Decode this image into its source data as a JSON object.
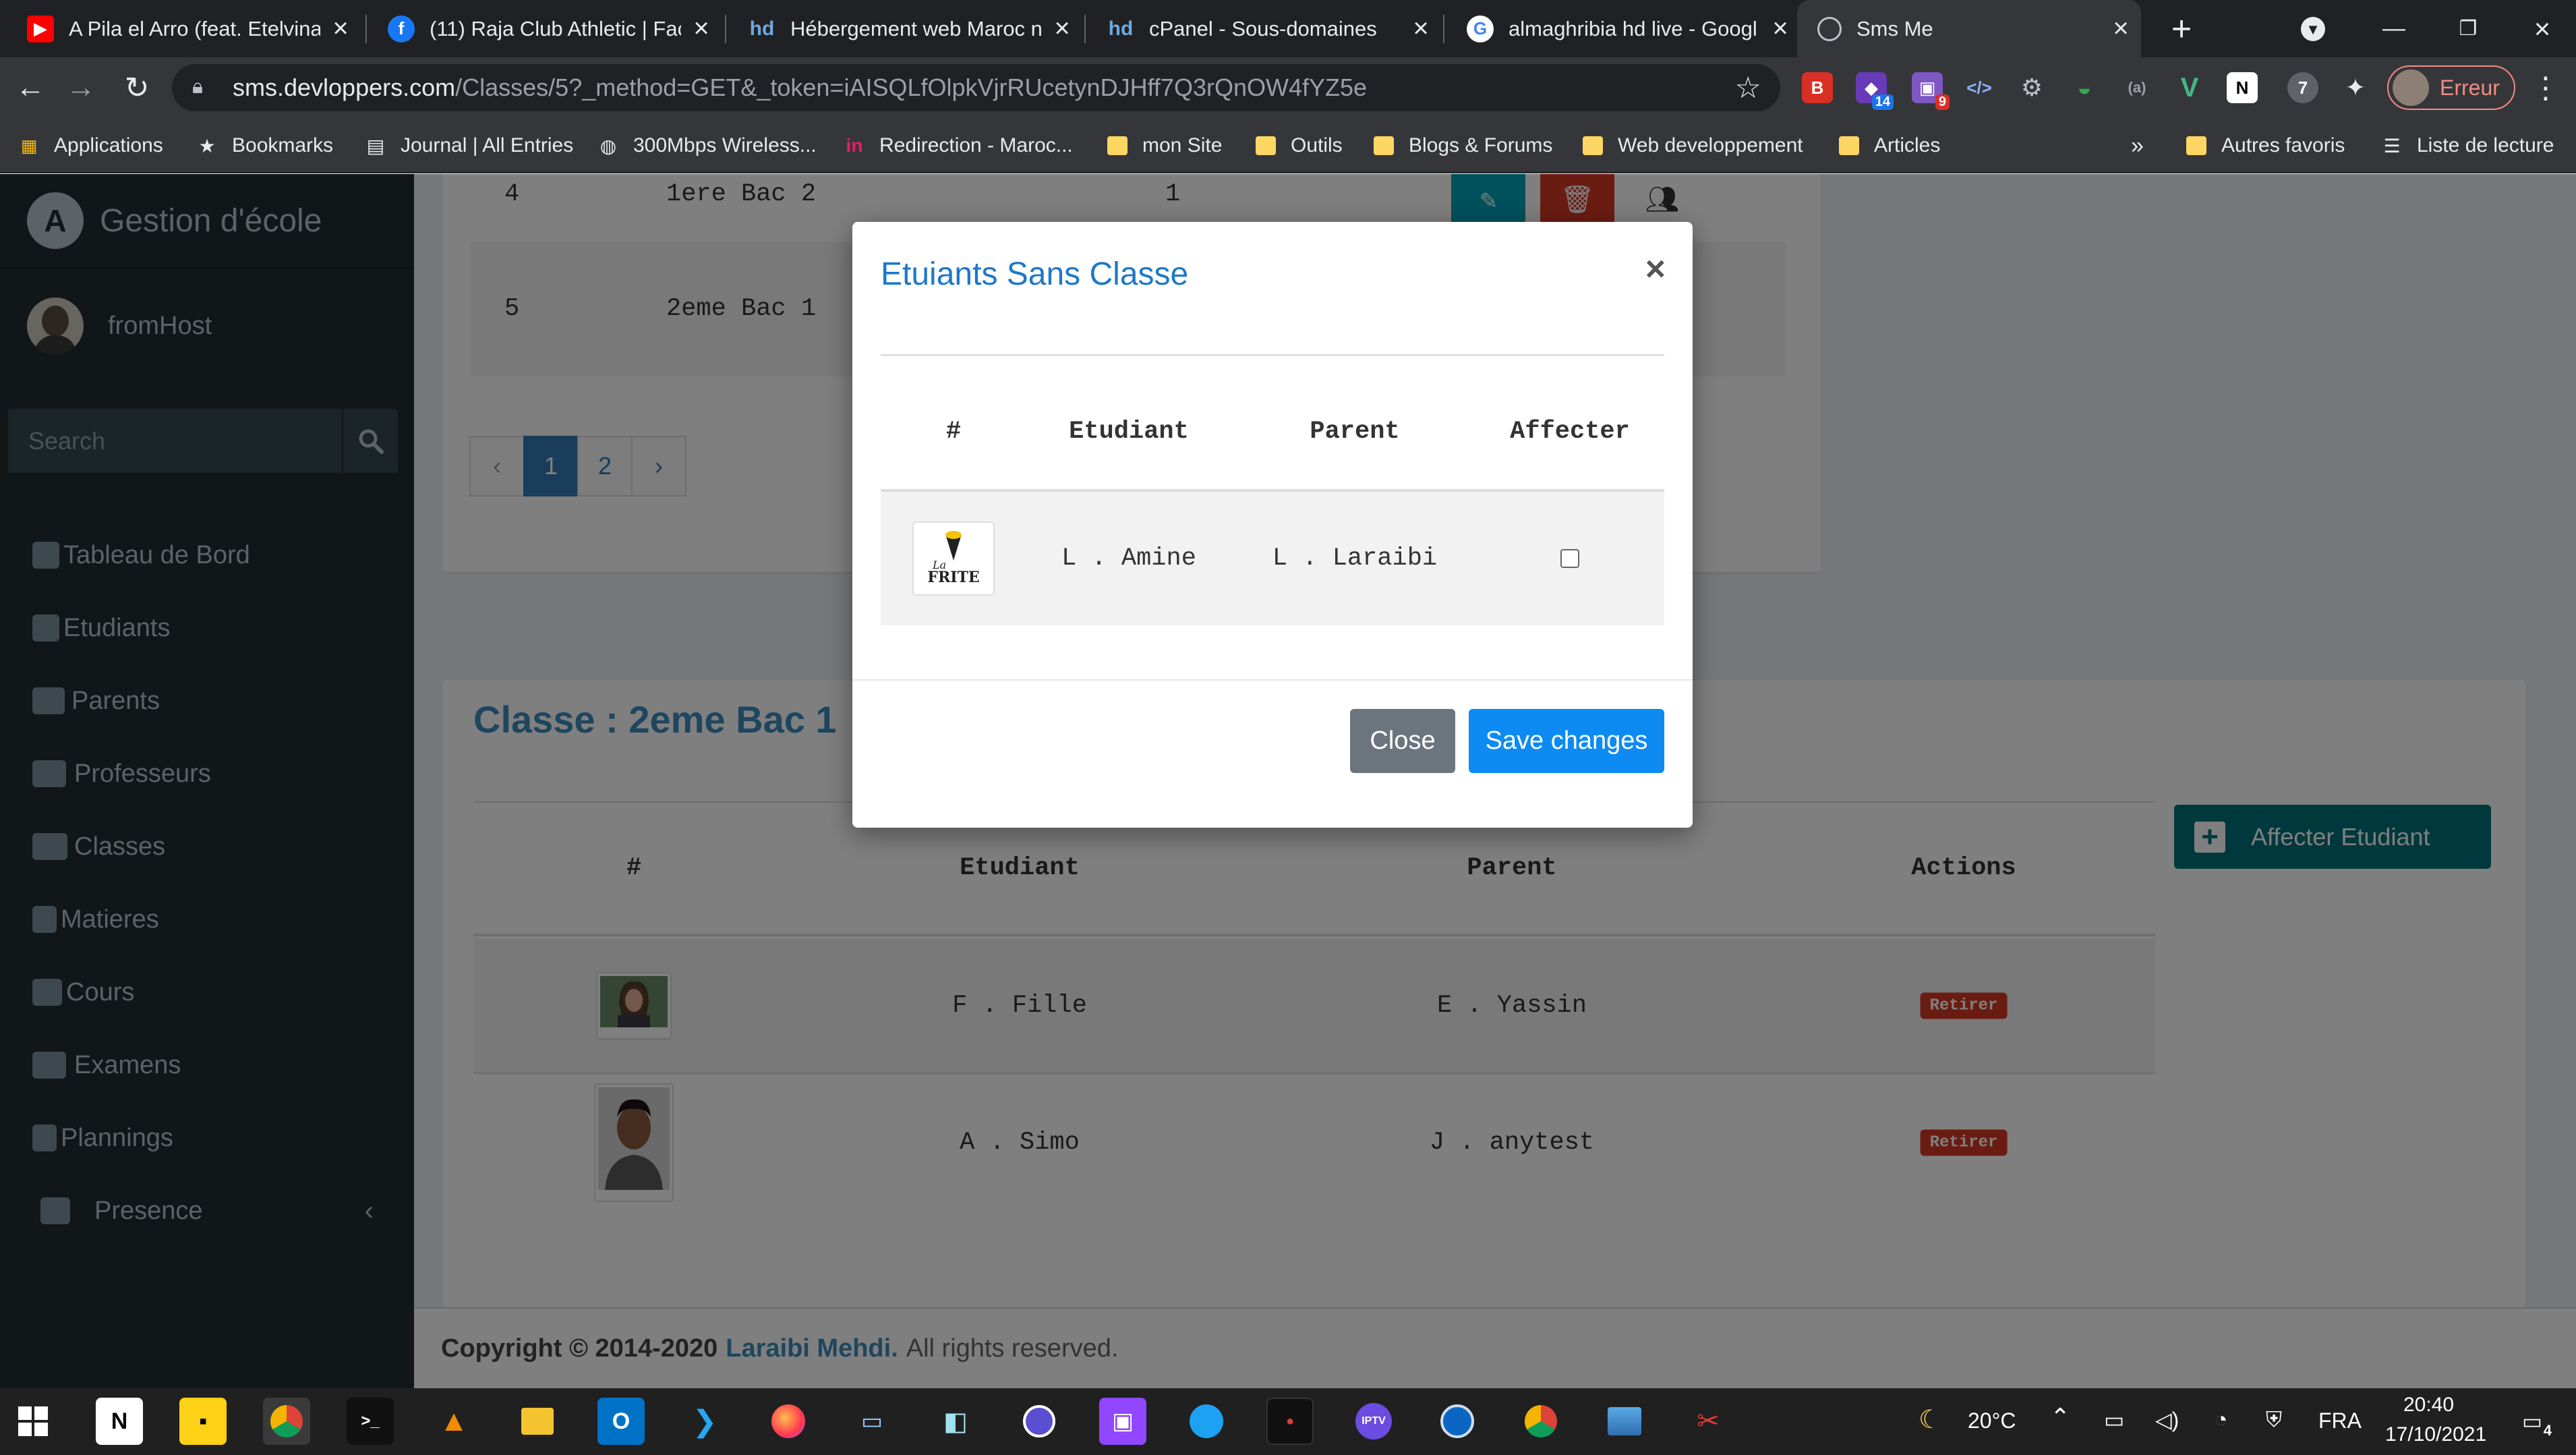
{
  "browser": {
    "tabs": [
      {
        "title": "A Pila el Arro (feat. Etelvina",
        "icon": "youtube-icon",
        "color": "#ff0000"
      },
      {
        "title": "(11) Raja Club Athletic | Face",
        "icon": "facebook-icon",
        "color": "#1877f2"
      },
      {
        "title": "Hébergement web Maroc n",
        "icon": "hd-icon",
        "color": "#2c6fba"
      },
      {
        "title": "cPanel - Sous-domaines",
        "icon": "hd-icon",
        "color": "#2c6fba"
      },
      {
        "title": "almaghribia hd live - Googl",
        "icon": "google-icon",
        "color": "#ffffff"
      },
      {
        "title": "Sms Me",
        "icon": "globe-icon",
        "color": "#bdc1c6"
      }
    ],
    "url_host": "sms.devloppers.com",
    "url_path": "/Classes/5?_method=GET&_token=iAISQLfOlpkVjrRUcetynDJHff7Q3rQnOW4fYZ5e",
    "profile_label": "Erreur",
    "extension_badges": [
      "14",
      "9"
    ],
    "bookmarks": [
      {
        "label": "Applications",
        "icon": "apps-grid-icon"
      },
      {
        "label": "Bookmarks",
        "icon": "star-icon"
      },
      {
        "label": "Journal | All Entries",
        "icon": "journal-icon"
      },
      {
        "label": "300Mbps Wireless...",
        "icon": "globe-icon"
      },
      {
        "label": "Redirection - Maroc...",
        "icon": "in-icon"
      },
      {
        "label": "mon Site",
        "icon": "folder-icon"
      },
      {
        "label": "Outils",
        "icon": "folder-icon"
      },
      {
        "label": "Blogs & Forums",
        "icon": "folder-icon"
      },
      {
        "label": "Web developpement",
        "icon": "folder-icon"
      },
      {
        "label": "Articles",
        "icon": "folder-icon"
      }
    ],
    "bookmarks_more": "»",
    "other_bookmarks": "Autres favoris",
    "reading_list": "Liste de lecture"
  },
  "sidebar": {
    "brand": "Gestion d'école",
    "user": "fromHost",
    "search_placeholder": "Search",
    "items": [
      {
        "label": "Tableau de Bord",
        "icon": "dashboard-icon"
      },
      {
        "label": "Etudiants",
        "icon": "student-icon"
      },
      {
        "label": "Parents",
        "icon": "users-icon"
      },
      {
        "label": "Professeurs",
        "icon": "teacher-icon"
      },
      {
        "label": "Classes",
        "icon": "users-group-icon"
      },
      {
        "label": "Matieres",
        "icon": "subject-icon"
      },
      {
        "label": "Cours",
        "icon": "book-icon"
      },
      {
        "label": "Examens",
        "icon": "exam-icon"
      },
      {
        "label": "Plannings",
        "icon": "calendar-icon"
      },
      {
        "label": "Presence",
        "icon": "table-icon"
      }
    ]
  },
  "classes_table": {
    "rows": [
      {
        "id": "4",
        "name": "1ere Bac 2",
        "count": "1"
      },
      {
        "id": "5",
        "name": "2eme Bac 1",
        "count": ""
      }
    ],
    "pagination": {
      "prev": "‹",
      "pages": [
        "1",
        "2"
      ],
      "next": "›",
      "active": "1"
    }
  },
  "class_detail": {
    "title": "Classe : 2eme Bac 1",
    "affecter_button": "Affecter Etudiant",
    "headers": {
      "num": "#",
      "student": "Etudiant",
      "parent": "Parent",
      "actions": "Actions"
    },
    "students": [
      {
        "student": "F . Fille",
        "parent": "E . Yassin",
        "action": "Retirer"
      },
      {
        "student": "A . Simo",
        "parent": "J . anytest",
        "action": "Retirer"
      }
    ]
  },
  "modal": {
    "title": "Etuiants Sans Classe",
    "close_symbol": "×",
    "headers": {
      "num": "#",
      "student": "Etudiant",
      "parent": "Parent",
      "assign": "Affecter"
    },
    "rows": [
      {
        "logo_top": "La",
        "logo_text": "FRITE",
        "student": "L . Amine",
        "parent": "L . Laraibi",
        "checked": false
      }
    ],
    "close_button": "Close",
    "save_button": "Save changes"
  },
  "footer": {
    "copyright": "Copyright © 2014-2020",
    "author": "Laraibi Mehdi.",
    "rights": "All rights reserved."
  },
  "taskbar": {
    "weather": "20°C",
    "language": "FRA",
    "time": "20:40",
    "date": "17/10/2021",
    "notifications": "4"
  },
  "colors": {
    "sidebar_bg": "#222d32",
    "primary": "#3c8dbc",
    "teal": "#00727a",
    "danger": "#d73925",
    "modal_save": "#1e88e5",
    "modal_close": "#6c757d"
  }
}
